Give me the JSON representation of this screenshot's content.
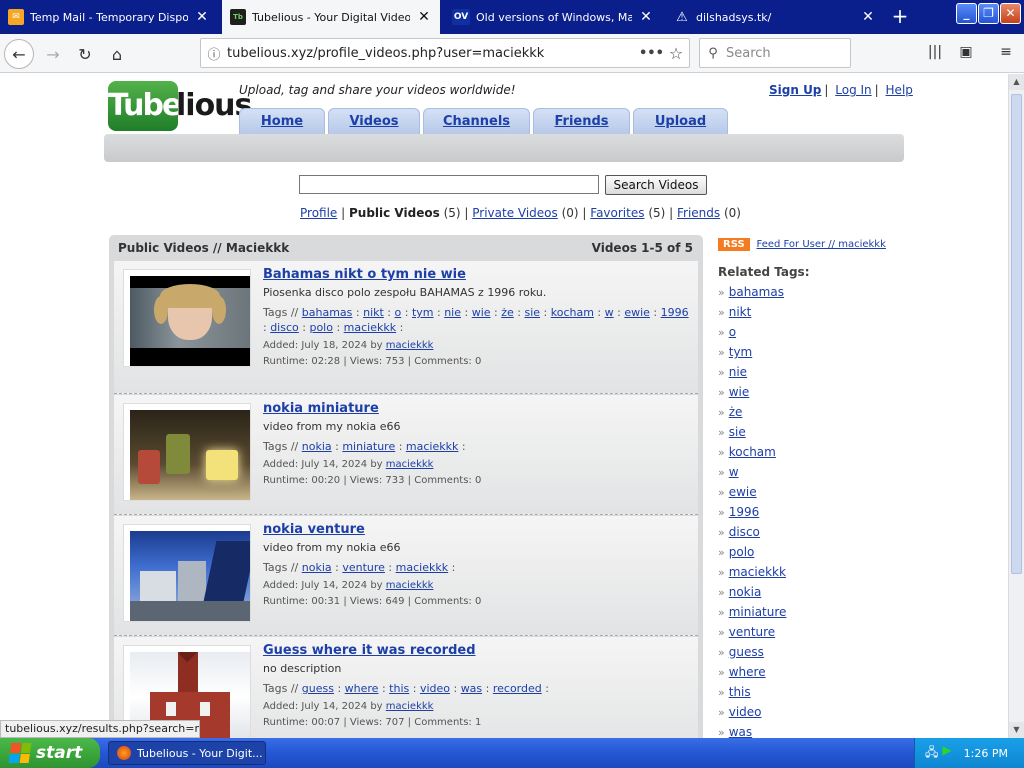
{
  "browser": {
    "tabs": [
      {
        "title": "Temp Mail - Temporary Disposable",
        "active": false,
        "icon": "mail-icon"
      },
      {
        "title": "Tubelious - Your Digital Video Rep",
        "active": true,
        "icon": "tubelious-icon"
      },
      {
        "title": "Old versions of Windows, Mac an",
        "active": false,
        "icon": "ov-icon"
      },
      {
        "title": "dilshadsys.tk/",
        "active": false,
        "icon": "warning-icon"
      }
    ],
    "ov_icon_text": "OV",
    "url": "tubelious.xyz/profile_videos.php?user=maciekkk",
    "search_placeholder": "Search",
    "status_text": "tubelious.xyz/results.php?search=nokia"
  },
  "site": {
    "logo_part1": "Tube",
    "logo_part2": "lious",
    "tagline": "Upload, tag and share your videos worldwide!",
    "top_links": {
      "signup": "Sign Up",
      "login": "Log In",
      "help": "Help"
    },
    "nav": [
      "Home",
      "Videos",
      "Channels",
      "Friends",
      "Upload"
    ],
    "search_button": "Search Videos",
    "subnav": {
      "profile": "Profile",
      "public": "Public Videos",
      "public_count": "(5)",
      "private": "Private Videos",
      "private_count": "(0)",
      "favorites": "Favorites",
      "favorites_count": "(5)",
      "friends": "Friends",
      "friends_count": "(0)"
    },
    "panel_title": "Public Videos // Maciekkk",
    "panel_count": "Videos 1-5 of 5",
    "tags_prefix": "Tags //",
    "added_prefix": "Added:",
    "by_word": "by",
    "runtime_prefix": "Runtime:",
    "views_prefix": "Views:",
    "comments_prefix": "Comments:",
    "videos": [
      {
        "title": "Bahamas nikt o tym nie wie",
        "description": "Piosenka disco polo zespołu BAHAMAS z 1996 roku.",
        "tags": [
          "bahamas",
          "nikt",
          "o",
          "tym",
          "nie",
          "wie",
          "że",
          "sie",
          "kocham",
          "w",
          "ewie",
          "1996",
          "disco",
          "polo",
          "maciekkk"
        ],
        "added": "July 18, 2024",
        "user": "maciekkk",
        "runtime": "02:28",
        "views": "753",
        "comments": "0"
      },
      {
        "title": "nokia miniature",
        "description": "video from my nokia e66",
        "tags": [
          "nokia",
          "miniature",
          "maciekkk"
        ],
        "added": "July 14, 2024",
        "user": "maciekkk",
        "runtime": "00:20",
        "views": "733",
        "comments": "0"
      },
      {
        "title": "nokia venture",
        "description": "video from my nokia e66",
        "tags": [
          "nokia",
          "venture",
          "maciekkk"
        ],
        "added": "July 14, 2024",
        "user": "maciekkk",
        "runtime": "00:31",
        "views": "649",
        "comments": "0"
      },
      {
        "title": "Guess where it was recorded",
        "description": "no description",
        "tags": [
          "guess",
          "where",
          "this",
          "video",
          "was",
          "recorded"
        ],
        "added": "July 14, 2024",
        "user": "maciekkk",
        "runtime": "00:07",
        "views": "707",
        "comments": "1"
      }
    ],
    "rss_badge": "RSS",
    "rss_link": "Feed For User // maciekkk",
    "related_title": "Related Tags:",
    "related_tags": [
      "bahamas",
      "nikt",
      "o",
      "tym",
      "nie",
      "wie",
      "że",
      "sie",
      "kocham",
      "w",
      "ewie",
      "1996",
      "disco",
      "polo",
      "maciekkk",
      "nokia",
      "miniature",
      "venture",
      "guess",
      "where",
      "this",
      "video",
      "was"
    ]
  },
  "taskbar": {
    "start_label": "start",
    "task_item": "Tubelious - Your Digit...",
    "clock": "1:26 PM"
  },
  "colors": {
    "link": "#1d3fa8",
    "tab_bar": "#0a1e8c",
    "logo_green": "#2f9430",
    "rss_orange": "#f47b1f",
    "taskbar_blue": "#2457d4"
  }
}
